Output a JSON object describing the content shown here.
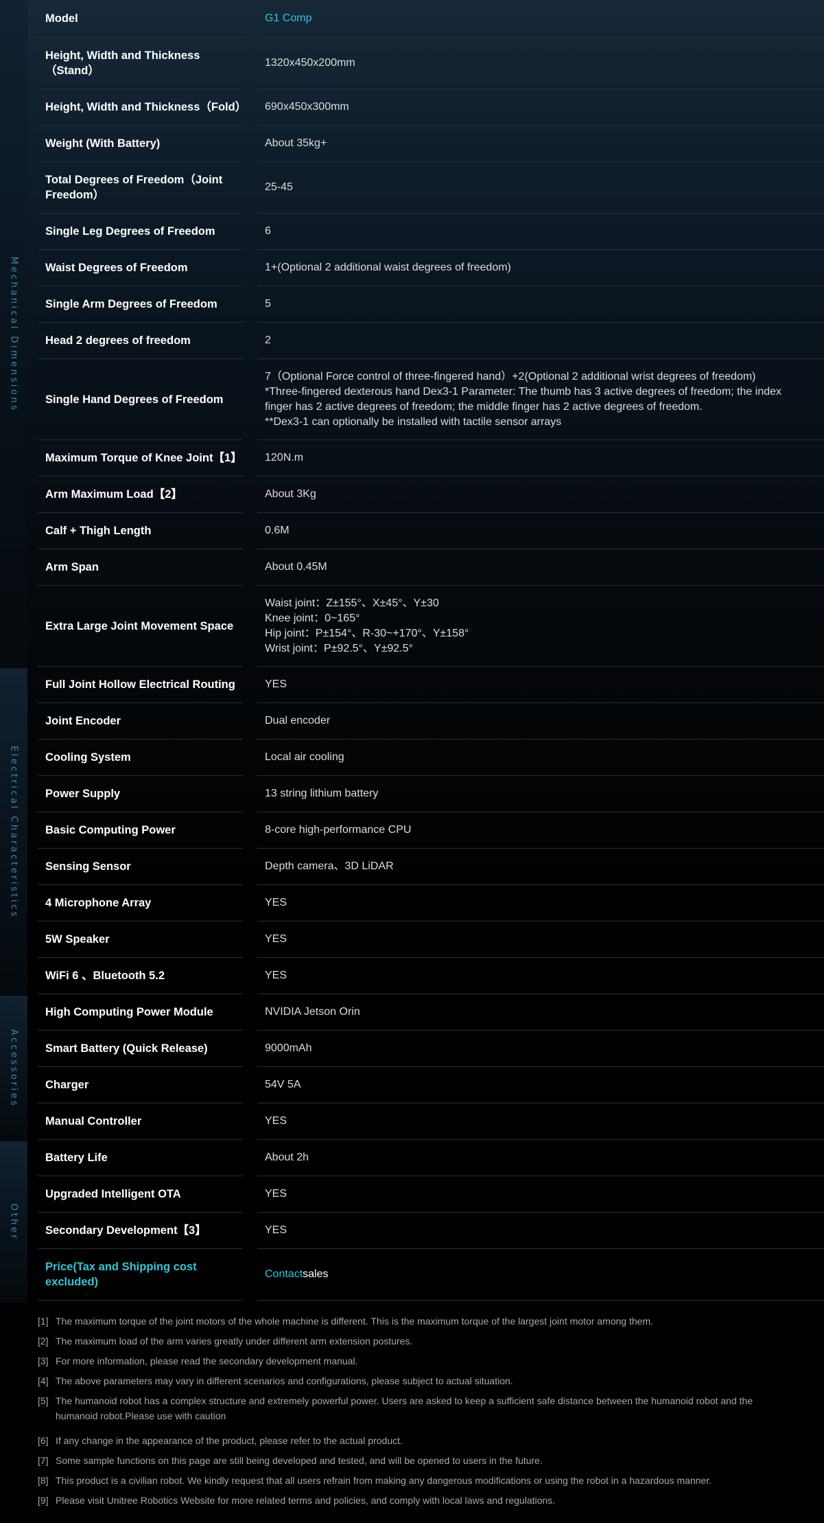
{
  "sidebar": [
    {
      "label": "Mechanical Dimensions"
    },
    {
      "label": "Electrical Characteristics"
    },
    {
      "label": "Accessories"
    },
    {
      "label": "Other"
    }
  ],
  "rows": [
    {
      "label": "Model",
      "value": "G1 Comp"
    },
    {
      "label": "Height, Width and Thickness（Stand）",
      "value": "1320x450x200mm"
    },
    {
      "label": "Height, Width and Thickness（Fold）",
      "value": "690x450x300mm"
    },
    {
      "label": "Weight (With Battery)",
      "value": "About 35kg+"
    },
    {
      "label": "Total Degrees of Freedom（Joint Freedom）",
      "value": "25-45"
    },
    {
      "label": "Single Leg Degrees of Freedom",
      "value": "6"
    },
    {
      "label": "Waist Degrees of Freedom",
      "value": "1+(Optional 2 additional waist degrees of freedom)"
    },
    {
      "label": "Single Arm Degrees of Freedom",
      "value": "5"
    },
    {
      "label": "Head 2 degrees of freedom",
      "value": "2"
    },
    {
      "label": "Single Hand Degrees of Freedom",
      "value": "7（Optional Force control of three-fingered hand）+2(Optional 2 additional wrist degrees of freedom)\n*Three-fingered dexterous hand Dex3-1 Parameter: The thumb has 3 active degrees of freedom; the index finger has 2 active degrees of freedom; the middle finger has 2 active degrees of freedom.\n**Dex3-1 can optionally be installed with tactile sensor arrays"
    },
    {
      "label": "Maximum Torque of Knee Joint【1】",
      "value": "120N.m"
    },
    {
      "label": "Arm Maximum Load【2】",
      "value": "About 3Kg"
    },
    {
      "label": "Calf + Thigh Length",
      "value": "0.6M"
    },
    {
      "label": "Arm Span",
      "value": "About 0.45M"
    },
    {
      "label": "Extra Large Joint Movement Space",
      "value": "Waist joint：Z±155°、X±45°、Y±30\nKnee joint：0~165°\nHip joint：P±154°、R-30~+170°、Y±158°\nWrist joint：P±92.5°、Y±92.5°"
    },
    {
      "label": "Full Joint Hollow Electrical Routing",
      "value": "YES"
    },
    {
      "label": "Joint Encoder",
      "value": "Dual encoder"
    },
    {
      "label": "Cooling System",
      "value": "Local air cooling"
    },
    {
      "label": "Power Supply",
      "value": "13 string lithium battery"
    },
    {
      "label": "Basic Computing Power",
      "value": "8-core high-performance CPU"
    },
    {
      "label": "Sensing Sensor",
      "value": "Depth camera、3D LiDAR"
    },
    {
      "label": "4 Microphone Array",
      "value": "YES"
    },
    {
      "label": "5W Speaker",
      "value": "YES"
    },
    {
      "label": "WiFi 6 、Bluetooth 5.2",
      "value": "YES"
    },
    {
      "label": "High Computing Power Module",
      "value": "NVIDIA Jetson Orin"
    },
    {
      "label": "Smart Battery (Quick Release)",
      "value": "9000mAh"
    },
    {
      "label": "Charger",
      "value": "54V 5A"
    },
    {
      "label": "Manual Controller",
      "value": "YES"
    },
    {
      "label": "Battery Life",
      "value": "About 2h"
    },
    {
      "label": "Upgraded Intelligent OTA",
      "value": "YES"
    },
    {
      "label": "Secondary Development【3】",
      "value": "YES"
    },
    {
      "label": "Price(Tax and Shipping cost excluded)",
      "value": ""
    }
  ],
  "price": {
    "link_text": "Contact",
    "suffix": " sales"
  },
  "notes": [
    {
      "num": "[1]",
      "text": "The maximum torque of the joint motors of the whole machine is different. This is the maximum torque of the largest joint motor among them."
    },
    {
      "num": "[2]",
      "text": "The maximum load of the arm varies greatly under different arm extension postures."
    },
    {
      "num": "[3]",
      "text": "For more information, please read the secondary development manual."
    },
    {
      "num": "[4]",
      "text": "The above parameters may vary in different scenarios and configurations, please subject to actual situation."
    },
    {
      "num": "[5]",
      "text": "The humanoid robot has a complex structure and extremely powerful power. Users are asked to keep a sufficient safe distance between the humanoid robot and the humanoid robot.Please use with caution"
    },
    {
      "num": "[6]",
      "text": "If any change in the appearance of the product, please refer to the actual product."
    },
    {
      "num": "[7]",
      "text": "Some sample functions on this page are still being developed and tested, and will be opened to users in the future."
    },
    {
      "num": "[8]",
      "text": "This product is a civilian robot. We kindly request that all users refrain from making any dangerous modifications or using the robot in a hazardous manner."
    },
    {
      "num": "[9]",
      "text": "Please visit Unitree Robotics Website for more related terms and policies, and comply with local laws and regulations."
    }
  ],
  "colors": {
    "accent": "#2fc6d8",
    "background": "#000000",
    "sidebar_label": "#3f8aa3"
  }
}
